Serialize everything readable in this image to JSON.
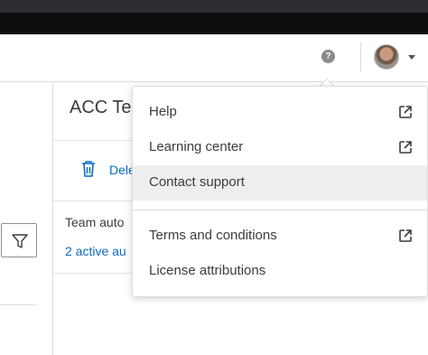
{
  "header": {
    "help_icon": "?",
    "avatar": "user-avatar",
    "avatar_caret": "chevron-down-icon"
  },
  "page": {
    "title": "ACC Tes",
    "toolbar": {
      "delete_label": "Dele"
    },
    "rows": [
      {
        "name": "Team auto",
        "status": "2 active au"
      }
    ]
  },
  "menu": {
    "items": [
      {
        "label": "Help",
        "external": true
      },
      {
        "label": "Learning center",
        "external": true
      },
      {
        "label": "Contact support",
        "external": false
      }
    ],
    "items_secondary": [
      {
        "label": "Terms and conditions",
        "external": true
      },
      {
        "label": "License attributions",
        "external": false
      }
    ]
  },
  "colors": {
    "accent": "#0a6cc2",
    "text": "#3c3c3c",
    "hover": "#eeeeee",
    "chrome": "#0d0d0f"
  }
}
